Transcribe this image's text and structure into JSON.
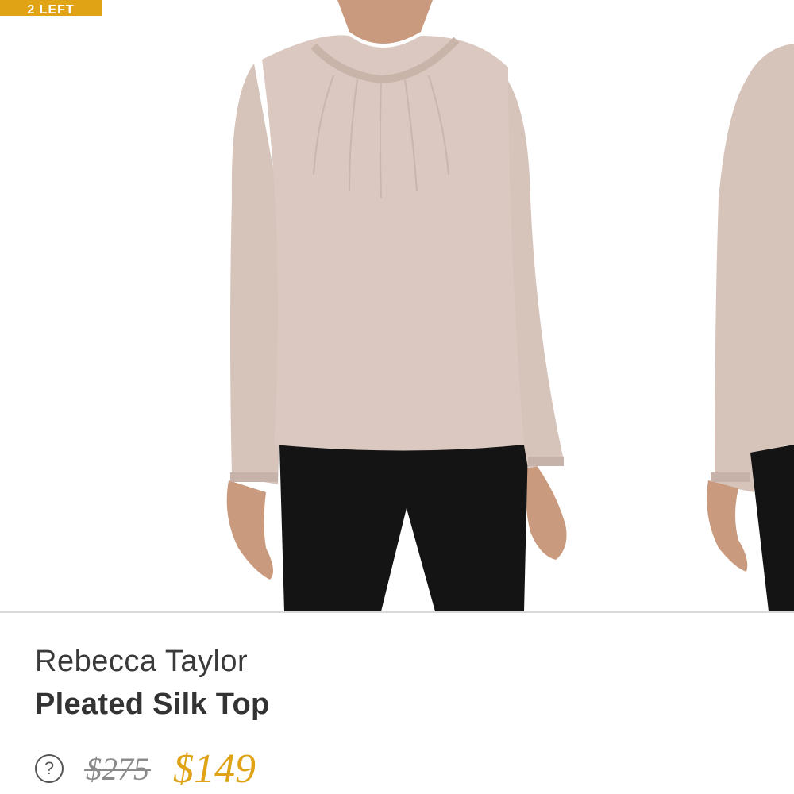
{
  "badge": {
    "label": "2 LEFT"
  },
  "product": {
    "brand": "Rebecca Taylor",
    "name": "Pleated Silk Top",
    "original_price": "$275",
    "sale_price": "$149"
  },
  "icons": {
    "help": "?"
  },
  "colors": {
    "accent": "#e0a315",
    "sale_price": "#e0a315",
    "original_price": "#8a8a8a",
    "blouse": "#d9c7bf",
    "pants": "#141414",
    "skin": "#c99a7e"
  }
}
